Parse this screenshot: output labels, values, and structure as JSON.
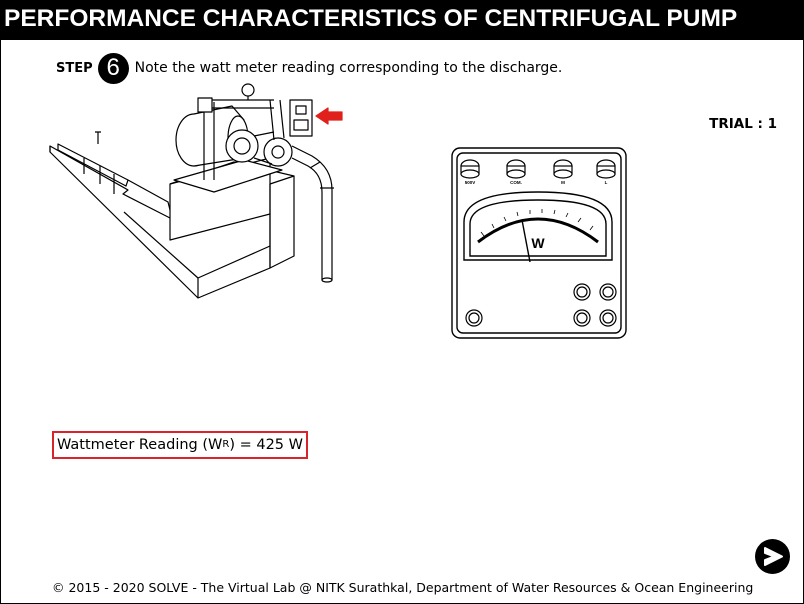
{
  "header": {
    "title": "PERFORMANCE CHARACTERISTICS OF CENTRIFUGAL PUMP"
  },
  "step": {
    "label": "STEP",
    "number": "6",
    "instruction": "Note the watt meter reading corresponding to the discharge."
  },
  "trial": {
    "label": "TRIAL : 1"
  },
  "wattmeter": {
    "terminals": [
      "500V",
      "COM.",
      "M",
      "L"
    ],
    "dial_symbol": "W",
    "accent_color": "#e0201b"
  },
  "reading": {
    "prefix": "Wattmeter Reading (W",
    "subscript": "R",
    "suffix": ") = 425 W",
    "box_color": "#d9242c"
  },
  "navigation": {
    "next_icon": "next-arrow-icon"
  },
  "footer": {
    "copyright": "© 2015 - 2020 SOLVE - The Virtual Lab @ NITK Surathkal, Department of Water Resources & Ocean Engineering"
  }
}
